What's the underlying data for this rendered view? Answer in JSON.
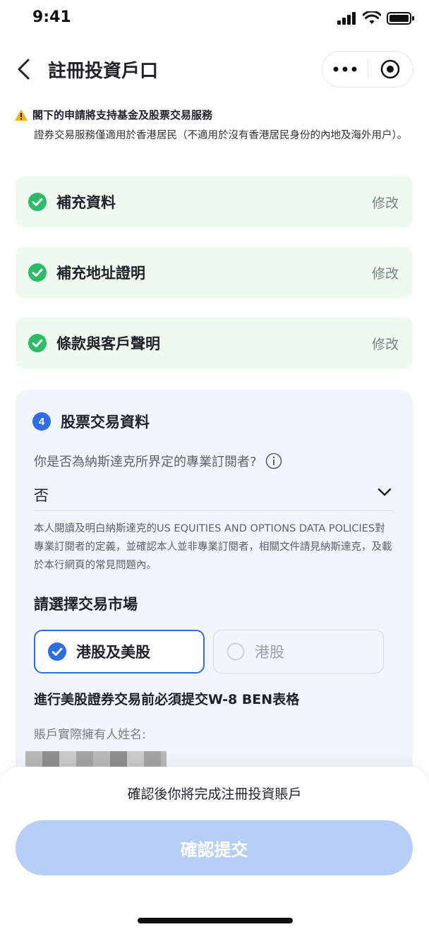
{
  "status_bar": {
    "time": "9:41"
  },
  "nav": {
    "title": "註冊投資戶口"
  },
  "notice": {
    "title": "閣下的申請將支持基金及股票交易服務",
    "body": "證券交易服務僅適用於香港居民（不適用於沒有香港居民身份的內地及海外用户）。"
  },
  "steps": [
    {
      "label": "補充資料",
      "edit": "修改"
    },
    {
      "label": "補充地址證明",
      "edit": "修改"
    },
    {
      "label": "條款與客戶聲明",
      "edit": "修改"
    }
  ],
  "stock_section": {
    "number": "4",
    "title": "股票交易資料",
    "question": "你是否為納斯達克所界定的專業訂閱者?",
    "answer": "否",
    "disclaimer": "本人閱讀及明白納斯達克的US EQUITIES AND OPTIONS DATA POLICIES對專業訂閱者的定義，並確認本人並非專業訂閱者，相關文件請見納斯達克，及載於本行網頁的常見問題內。",
    "market_title": "請選擇交易市場",
    "markets": [
      {
        "label": "港股及美股",
        "selected": true
      },
      {
        "label": "港股",
        "selected": false
      }
    ],
    "w8_note": "進行美股證券交易前必須提交W-8 BEN表格",
    "owner_label": "賬戶實際擁有人姓名:"
  },
  "bottom": {
    "note": "確認後你將完成注冊投資賬戶",
    "submit_label": "確認提交"
  },
  "colors": {
    "accent": "#2f6ce5",
    "success": "#2dbb6a",
    "step_bg": "#eefaf0",
    "card_bg": "#f1f5fc",
    "submit_disabled": "#b6cef6"
  }
}
